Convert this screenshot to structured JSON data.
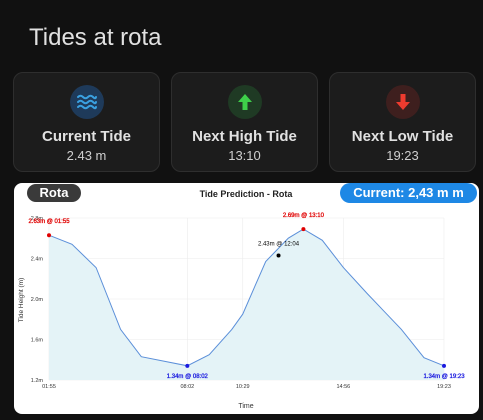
{
  "page": {
    "title": "Tides at rota"
  },
  "cards": [
    {
      "label": "Current Tide",
      "value": "2.43 m",
      "icon": "waves-icon",
      "icon_color": "#3aa0e0",
      "icon_bg": "#1e3a5a"
    },
    {
      "label": "Next High Tide",
      "value": "13:10",
      "icon": "arrow-up-icon",
      "icon_color": "#3ecf4a",
      "icon_bg": "#1f3a24"
    },
    {
      "label": "Next Low Tide",
      "value": "19:23",
      "icon": "arrow-down-icon",
      "icon_color": "#ef3b2f",
      "icon_bg": "#3e1f1e"
    }
  ],
  "chart_header": {
    "location_pill": "Rota",
    "current_pill": "Current: 2,43 m m"
  },
  "chart_data": {
    "type": "area",
    "title": "Tide Prediction - Rota",
    "xlabel": "Time",
    "ylabel": "Tide Height (m)",
    "ylim": [
      1.2,
      2.8
    ],
    "y_ticks": [
      "1.2m",
      "1.6m",
      "2.0m",
      "2.4m",
      "2.8m"
    ],
    "x_ticks": [
      "01:55",
      "08:02",
      "10:29",
      "14:56",
      "19:23"
    ],
    "series_color": "#5b8fd9",
    "fill_color": "#e4f3f7",
    "grid": true,
    "series": [
      {
        "points": [
          {
            "t": "01:55",
            "v": 2.63
          },
          {
            "t": "02:56",
            "v": 2.54
          },
          {
            "t": "04:00",
            "v": 2.31
          },
          {
            "t": "05:05",
            "v": 1.7
          },
          {
            "t": "06:00",
            "v": 1.43
          },
          {
            "t": "08:02",
            "v": 1.34
          },
          {
            "t": "09:00",
            "v": 1.45
          },
          {
            "t": "10:00",
            "v": 1.7
          },
          {
            "t": "10:29",
            "v": 1.85
          },
          {
            "t": "11:30",
            "v": 2.37
          },
          {
            "t": "12:30",
            "v": 2.6
          },
          {
            "t": "13:10",
            "v": 2.69
          },
          {
            "t": "14:00",
            "v": 2.58
          },
          {
            "t": "14:56",
            "v": 2.31
          },
          {
            "t": "16:00",
            "v": 2.05
          },
          {
            "t": "17:30",
            "v": 1.7
          },
          {
            "t": "18:30",
            "v": 1.42
          },
          {
            "t": "19:23",
            "v": 1.34
          }
        ]
      }
    ],
    "annotations": [
      {
        "t": "01:55",
        "v": 2.63,
        "label": "2.63m @ 01:55",
        "kind": "high"
      },
      {
        "t": "08:02",
        "v": 1.34,
        "label": "1.34m @ 08:02",
        "kind": "low"
      },
      {
        "t": "13:10",
        "v": 2.69,
        "label": "2.69m @ 13:10",
        "kind": "high"
      },
      {
        "t": "19:23",
        "v": 1.34,
        "label": "1.34m @ 19:23",
        "kind": "low"
      },
      {
        "t": "12:04",
        "v": 2.43,
        "label": "2.43m @ 12:04",
        "kind": "current"
      }
    ],
    "colors": {
      "high": "#e00000",
      "low": "#1a1adf",
      "current": "#000000"
    }
  }
}
